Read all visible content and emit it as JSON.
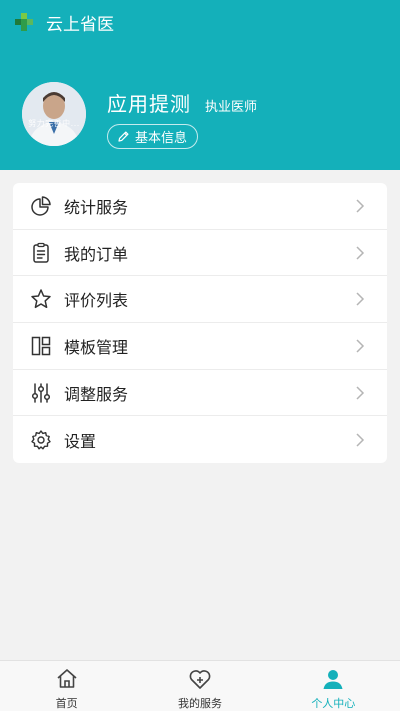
{
  "header": {
    "app_title": "云上省医",
    "logo_icon": "medical-cross-logo-icon"
  },
  "profile": {
    "avatar_caption": "努力完善中...",
    "name": "应用提测",
    "title": "执业医师",
    "info_button_label": "基本信息",
    "info_button_icon": "pencil-icon"
  },
  "menu": {
    "items": [
      {
        "label": "统计服务",
        "icon": "pie-chart-icon"
      },
      {
        "label": "我的订单",
        "icon": "clipboard-icon"
      },
      {
        "label": "评价列表",
        "icon": "star-icon"
      },
      {
        "label": "模板管理",
        "icon": "template-layout-icon"
      },
      {
        "label": "调整服务",
        "icon": "sliders-icon"
      },
      {
        "label": "设置",
        "icon": "gear-icon"
      }
    ],
    "chevron_icon": "chevron-right-icon"
  },
  "bottom_nav": {
    "items": [
      {
        "label": "首页",
        "icon": "home-icon",
        "active": false
      },
      {
        "label": "我的服务",
        "icon": "heart-plus-icon",
        "active": false
      },
      {
        "label": "个人中心",
        "icon": "user-icon",
        "active": true
      }
    ]
  },
  "colors": {
    "brand": "#14b0ba",
    "background": "#f2f2f2",
    "card": "#ffffff",
    "text": "#222222"
  }
}
